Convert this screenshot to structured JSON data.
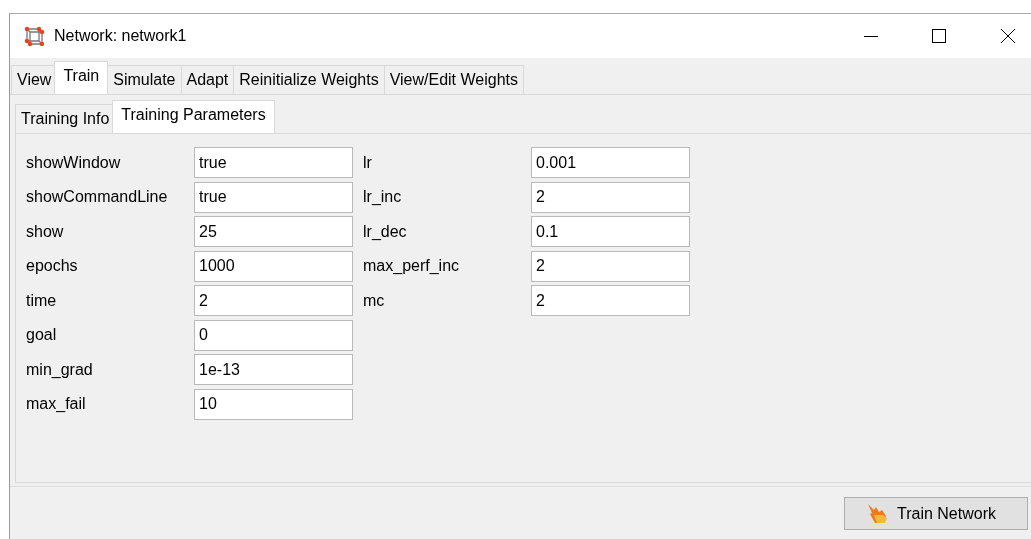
{
  "window": {
    "title": "Network: network1"
  },
  "tabs": [
    {
      "label": "View",
      "selected": false
    },
    {
      "label": "Train",
      "selected": true
    },
    {
      "label": "Simulate",
      "selected": false
    },
    {
      "label": "Adapt",
      "selected": false
    },
    {
      "label": "Reinitialize Weights",
      "selected": false
    },
    {
      "label": "View/Edit Weights",
      "selected": false
    }
  ],
  "subtabs": [
    {
      "label": "Training Info",
      "selected": false
    },
    {
      "label": "Training Parameters",
      "selected": true
    }
  ],
  "params_left": [
    {
      "label": "showWindow",
      "value": "true"
    },
    {
      "label": "showCommandLine",
      "value": "true"
    },
    {
      "label": "show",
      "value": "25"
    },
    {
      "label": "epochs",
      "value": "1000"
    },
    {
      "label": "time",
      "value": "2"
    },
    {
      "label": "goal",
      "value": "0"
    },
    {
      "label": "min_grad",
      "value": "1e-13"
    },
    {
      "label": "max_fail",
      "value": "10"
    }
  ],
  "params_right": [
    {
      "label": "lr",
      "value": "0.001"
    },
    {
      "label": "lr_inc",
      "value": "2"
    },
    {
      "label": "lr_dec",
      "value": "0.1"
    },
    {
      "label": "max_perf_inc",
      "value": "2"
    },
    {
      "label": "mc",
      "value": "2"
    }
  ],
  "train_button": {
    "label": "Train Network"
  }
}
